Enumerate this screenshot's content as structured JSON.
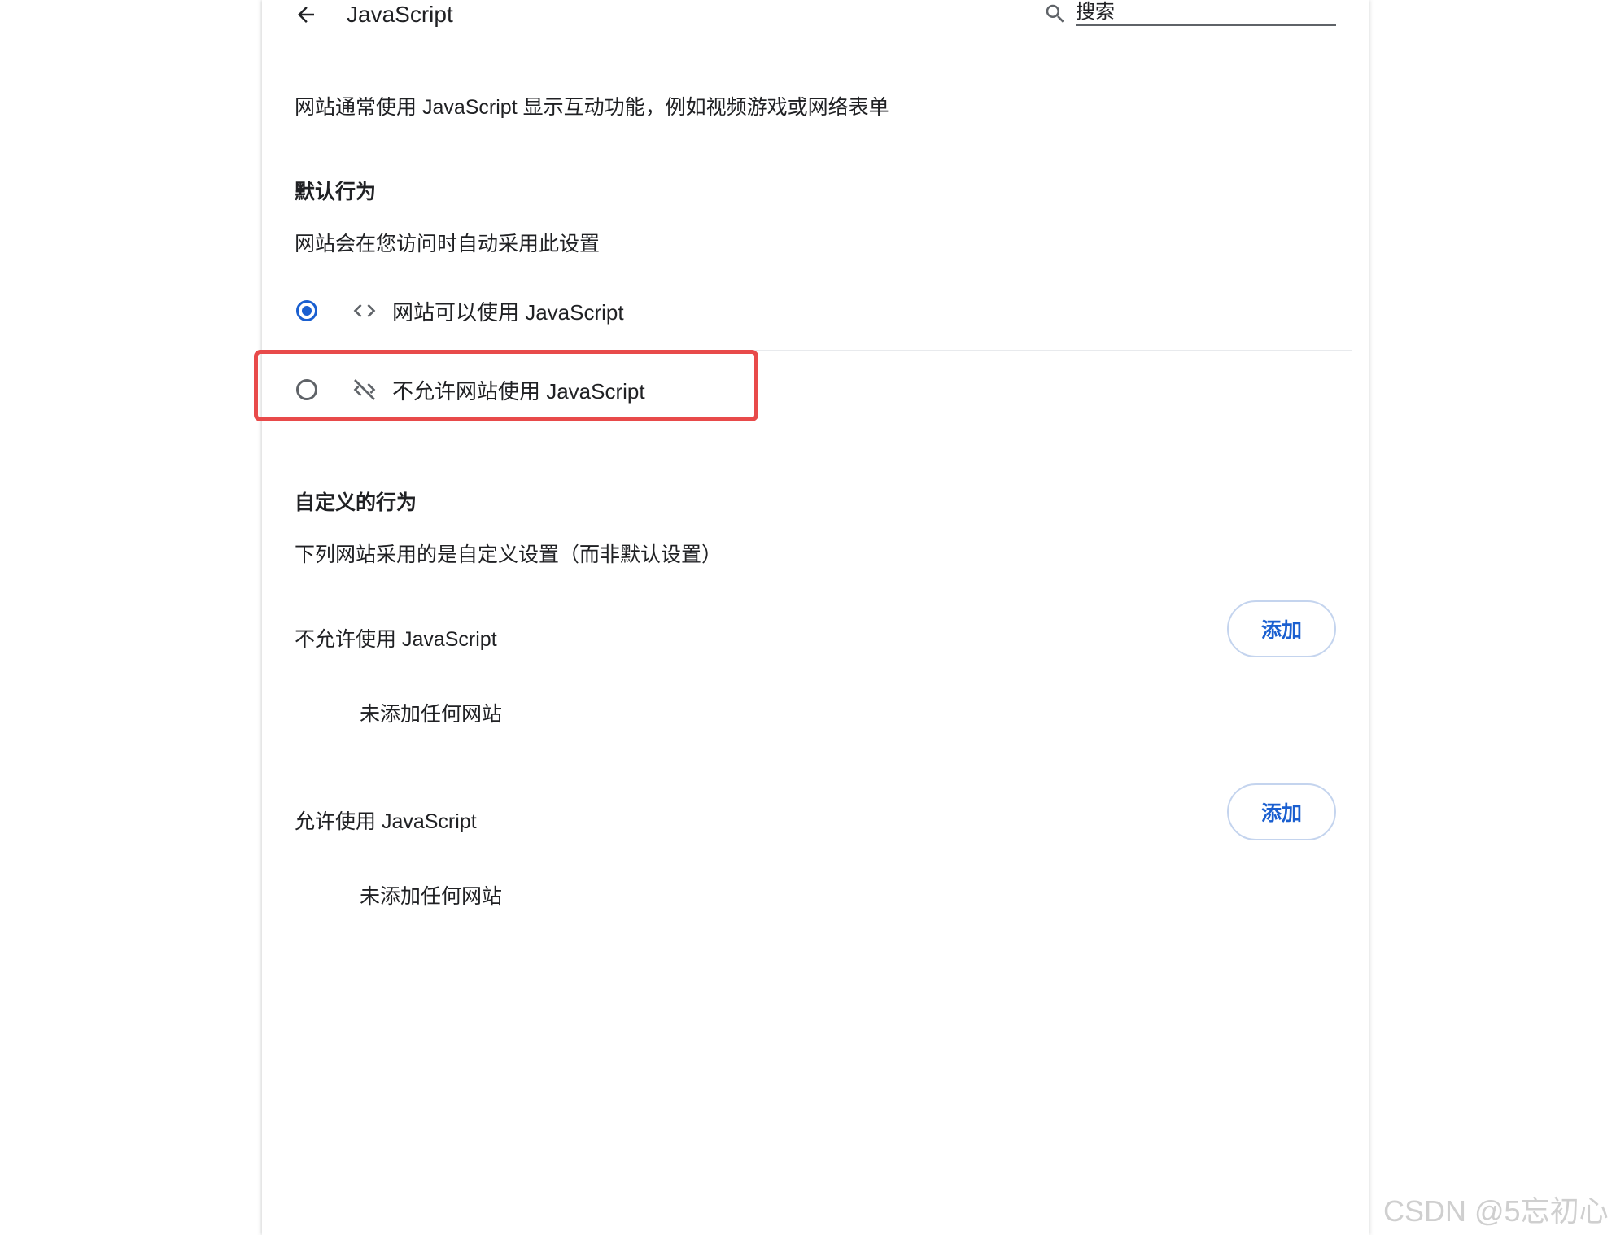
{
  "header": {
    "title": "JavaScript",
    "search_placeholder": "搜索"
  },
  "description": "网站通常使用 JavaScript 显示互动功能，例如视频游戏或网络表单",
  "default_behavior": {
    "title": "默认行为",
    "subtitle": "网站会在您访问时自动采用此设置",
    "options": [
      {
        "label": "网站可以使用 JavaScript",
        "icon": "code-icon",
        "selected": true
      },
      {
        "label": "不允许网站使用 JavaScript",
        "icon": "code-off-icon",
        "selected": false
      }
    ]
  },
  "custom_behavior": {
    "title": "自定义的行为",
    "subtitle": "下列网站采用的是自定义设置（而非默认设置）",
    "lists": [
      {
        "label": "不允许使用 JavaScript",
        "add_label": "添加",
        "empty_text": "未添加任何网站"
      },
      {
        "label": "允许使用 JavaScript",
        "add_label": "添加",
        "empty_text": "未添加任何网站"
      }
    ]
  },
  "colors": {
    "accent": "#1a5fd0",
    "highlight_border": "#e84a4a"
  },
  "watermark": "CSDN @5忘初心"
}
